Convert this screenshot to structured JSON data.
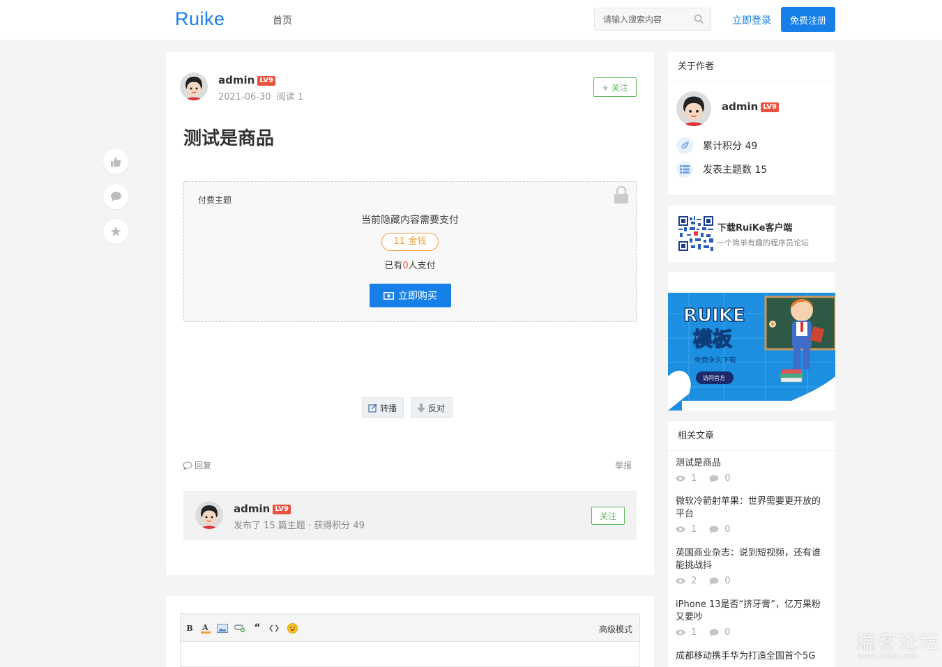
{
  "header": {
    "logo": "Ruike",
    "nav_home": "首页",
    "search_placeholder": "请输入搜索内容",
    "login": "立即登录",
    "register": "免费注册"
  },
  "post": {
    "author": "admin",
    "level": "LV9",
    "date": "2021-06-30",
    "read_label": "阅读 1",
    "follow": "+ 关注",
    "title": "测试是商品",
    "paid": {
      "label": "付费主题",
      "hint": "当前隐藏内容需要支付",
      "price": "11 金钱",
      "count_prefix": "已有",
      "count": "0",
      "count_suffix": "人支付",
      "buy": "立即购买"
    },
    "share": "转播",
    "oppose": "反对",
    "reply": "回复",
    "report": "举报"
  },
  "author_box": {
    "name": "admin",
    "level": "LV9",
    "desc": "发布了 15 篇主题 · 获得积分 49",
    "follow": "关注"
  },
  "editor": {
    "tools": [
      "B",
      "A",
      "image",
      "link",
      "quote",
      "code",
      "emoji"
    ],
    "bold_label": "B",
    "color_label": "A",
    "quote_label": "“",
    "advanced": "高级模式"
  },
  "sidebar": {
    "about": {
      "title": "关于作者",
      "name": "admin",
      "level": "LV9",
      "points": "累计积分 49",
      "topics": "发表主题数 15"
    },
    "app": {
      "title": "下载RuiKe客户端",
      "subtitle": "一个简单有趣的程序员论坛"
    },
    "banner": {
      "headline1": "RUIKE",
      "headline2": "模板",
      "tagline": "免费永久下载",
      "button": "访问官方"
    },
    "related": {
      "title": "相关文章",
      "items": [
        {
          "title": "测试是商品",
          "views": "1",
          "comments": "0"
        },
        {
          "title": "微软冷箭射苹果：世界需要更开放的平台",
          "views": "1",
          "comments": "0"
        },
        {
          "title": "英国商业杂志：说到短视频，还有谁能挑战抖",
          "views": "2",
          "comments": "0"
        },
        {
          "title": "iPhone 13是否“挤牙膏”，亿万果粉又要吵",
          "views": "1",
          "comments": "0"
        },
        {
          "title": "成都移动携手华为打造全国首个5G",
          "views": "",
          "comments": ""
        }
      ]
    }
  },
  "watermark": {
    "main": "瑞客论坛",
    "sub": "www.ruikei.com"
  },
  "colors": {
    "brand_blue": "#1680e8",
    "follow_green": "#5fb85f",
    "level_red": "#e8523f",
    "price_orange": "#f0a141"
  }
}
